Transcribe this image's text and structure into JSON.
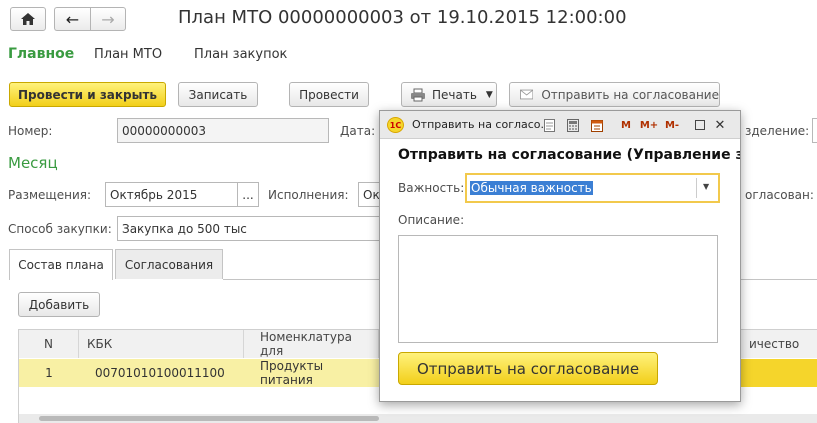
{
  "window": {
    "title": "План МТО 00000000003 от 19.10.2015 12:00:00"
  },
  "nav_tabs": [
    "Главное",
    "План МТО",
    "План закупок"
  ],
  "toolbar": {
    "post_close_label": "Провести и закрыть",
    "save_label": "Записать",
    "post_label": "Провести",
    "print_label": "Печать",
    "send_label": "Отправить на согласование"
  },
  "form": {
    "number_label": "Номер:",
    "number_value": "00000000003",
    "date_label": "Дата:",
    "division_label": "зделение:",
    "month_section": "Месяц",
    "placement_label": "Размещения:",
    "placement_value": "Октябрь 2015",
    "ellipsis": "...",
    "execution_label": "Исполнения:",
    "execution_value": "Ок",
    "agreed_label": "огласован:",
    "method_label": "Способ закупки:",
    "method_value": "Закупка до 500 тыс"
  },
  "content_tabs": [
    "Состав плана",
    "Согласования"
  ],
  "table": {
    "add_label": "Добавить",
    "headers": [
      "N",
      "КБК",
      "Номенклатура для",
      "ичество"
    ],
    "rows": [
      {
        "n": "1",
        "kbk": "00701010100011100",
        "item": "Продукты питания"
      }
    ]
  },
  "dialog": {
    "title": "Отправить на согласо...",
    "logo": "1С",
    "heading": "Отправить на согласование (Управление за",
    "importance_label": "Важность:",
    "importance_value": "Обычная важность",
    "description_label": "Описание:",
    "description_value": "",
    "submit_label": "Отправить на согласование",
    "titlebar_buttons": [
      "M",
      "M+",
      "M-"
    ]
  },
  "colors": {
    "accent_green": "#3a9b41",
    "button_yellow": "#f5d52b",
    "row_highlight": "#f8f0a4"
  }
}
